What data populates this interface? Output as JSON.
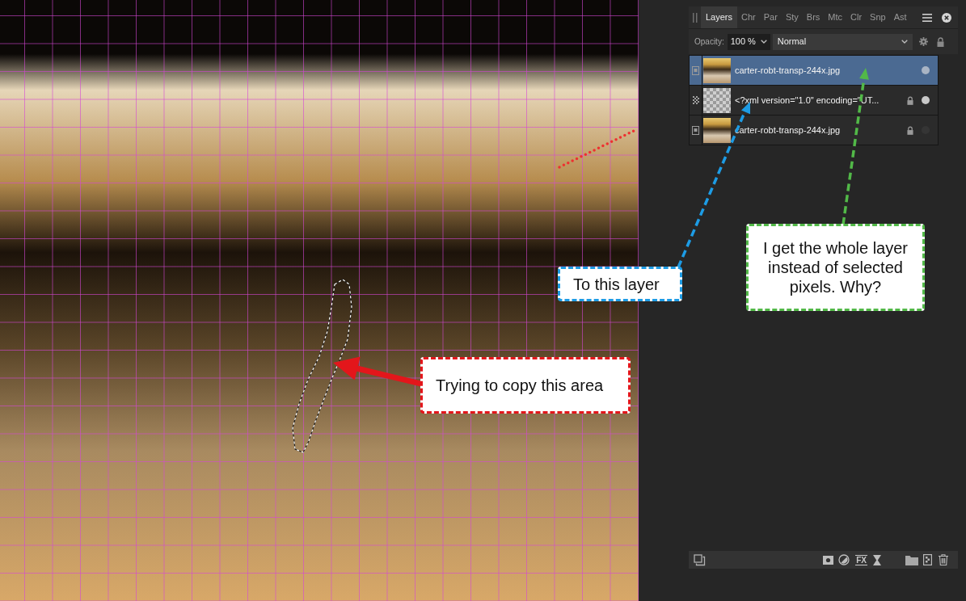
{
  "annotations": [
    {
      "kind": "solid_arrow",
      "text": "Trying to copy this area",
      "color": "#e3161b"
    },
    {
      "kind": "dashed_arrow",
      "text": "To this layer",
      "color": "#1d9ce5"
    },
    {
      "kind": "dashed_arrow",
      "text": "I get the whole layer instead of selected pixels. Why?",
      "color": "#52b948"
    }
  ],
  "layers_panel": {
    "tabs": [
      {
        "label": "Layers",
        "selected": true
      },
      {
        "label": "Chr",
        "selected": false
      },
      {
        "label": "Par",
        "selected": false
      },
      {
        "label": "Sty",
        "selected": false
      },
      {
        "label": "Brs",
        "selected": false
      },
      {
        "label": "Mtc",
        "selected": false
      },
      {
        "label": "Clr",
        "selected": false
      },
      {
        "label": "Snp",
        "selected": false
      },
      {
        "label": "Ast",
        "selected": false
      }
    ],
    "opacity": {
      "label": "Opacity:",
      "value": "100 %"
    },
    "blend_mode": "Normal",
    "layers": [
      {
        "name": "carter-robt-transp-244x.jpg",
        "kind": "pixel",
        "selected": true,
        "locked": false,
        "visible": true
      },
      {
        "name": "<?xml version=\"1.0\" encoding=\"UT...",
        "kind": "embedded",
        "selected": false,
        "locked": true,
        "visible": true
      },
      {
        "name": "carter-robt-transp-244x.jpg",
        "kind": "pixel",
        "selected": false,
        "locked": true,
        "visible": false
      }
    ],
    "fx_label": "FX"
  }
}
